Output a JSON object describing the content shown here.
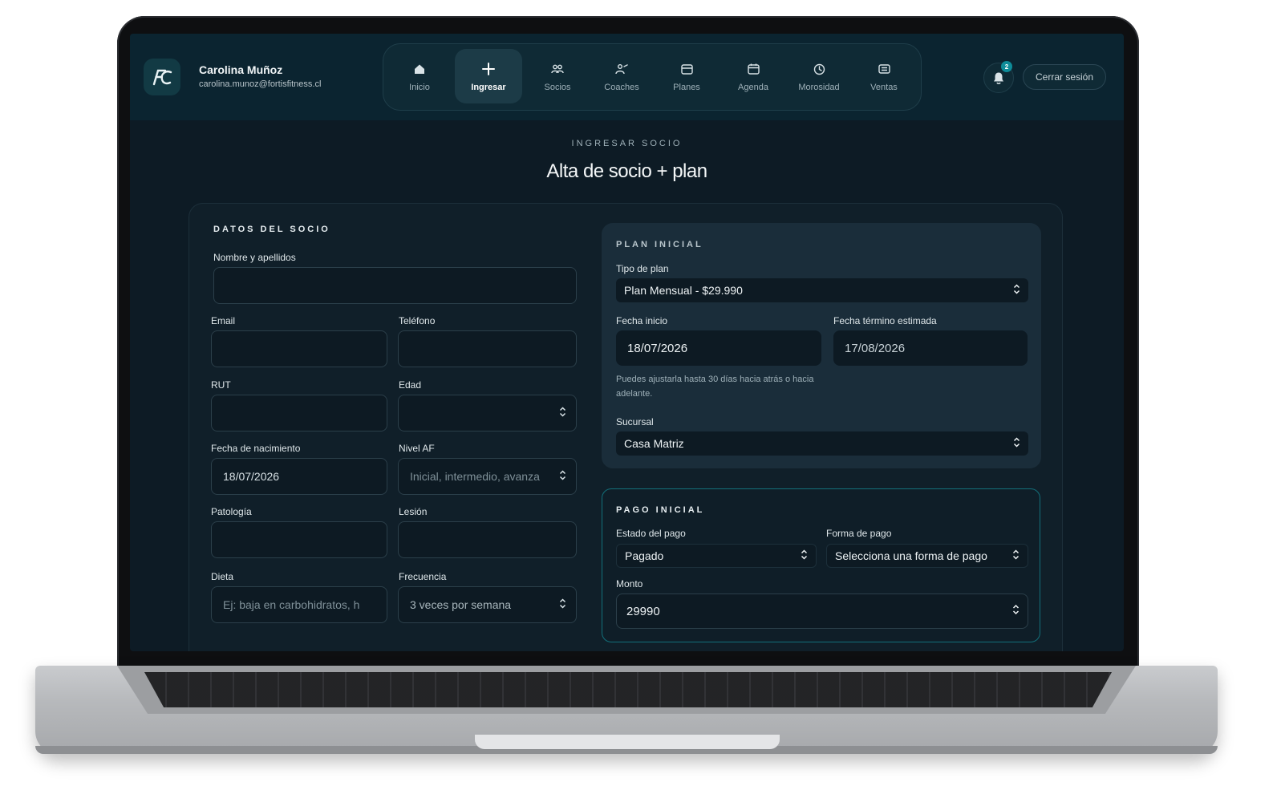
{
  "user": {
    "name": "Carolina Muñoz",
    "email": "carolina.munoz@fortisfitness.cl"
  },
  "nav": {
    "items": [
      {
        "label": "Inicio",
        "icon": "home-icon"
      },
      {
        "label": "Ingresar",
        "icon": "plus-icon",
        "active": true
      },
      {
        "label": "Socios",
        "icon": "users-icon"
      },
      {
        "label": "Coaches",
        "icon": "coach-icon"
      },
      {
        "label": "Planes",
        "icon": "card-icon"
      },
      {
        "label": "Agenda",
        "icon": "calendar-icon"
      },
      {
        "label": "Morosidad",
        "icon": "clock-icon"
      },
      {
        "label": "Ventas",
        "icon": "receipt-icon"
      }
    ]
  },
  "notifications": {
    "count": "2"
  },
  "logout_label": "Cerrar sesión",
  "page": {
    "eyebrow": "INGRESAR SOCIO",
    "title": "Alta de socio + plan"
  },
  "member": {
    "section": "DATOS DEL SOCIO",
    "name_label": "Nombre y apellidos",
    "email_label": "Email",
    "phone_label": "Teléfono",
    "rut_label": "RUT",
    "age_label": "Edad",
    "birth_label": "Fecha de nacimiento",
    "birth_value": "18/07/2026",
    "level_label": "Nivel AF",
    "level_placeholder": "Inicial, intermedio, avanza",
    "pathology_label": "Patología",
    "injury_label": "Lesión",
    "diet_label": "Dieta",
    "diet_placeholder": "Ej: baja en carbohidratos, h",
    "frequency_label": "Frecuencia",
    "frequency_value": "3 veces por semana"
  },
  "plan": {
    "section": "PLAN INICIAL",
    "type_label": "Tipo de plan",
    "type_value": "Plan Mensual - $29.990",
    "start_label": "Fecha inicio",
    "start_value": "18/07/2026",
    "end_label": "Fecha término estimada",
    "end_value": "17/08/2026",
    "hint": "Puedes ajustarla hasta 30 días hacia atrás o hacia adelante.",
    "branch_label": "Sucursal",
    "branch_value": "Casa Matriz"
  },
  "payment": {
    "section": "PAGO INICIAL",
    "status_label": "Estado del pago",
    "status_value": "Pagado",
    "method_label": "Forma de pago",
    "method_value": "Selecciona una forma de pago",
    "amount_label": "Monto",
    "amount_value": "29990"
  },
  "colors": {
    "accent": "#0e8c99",
    "background": "#0d1b25",
    "panel": "#1a2d3a"
  }
}
